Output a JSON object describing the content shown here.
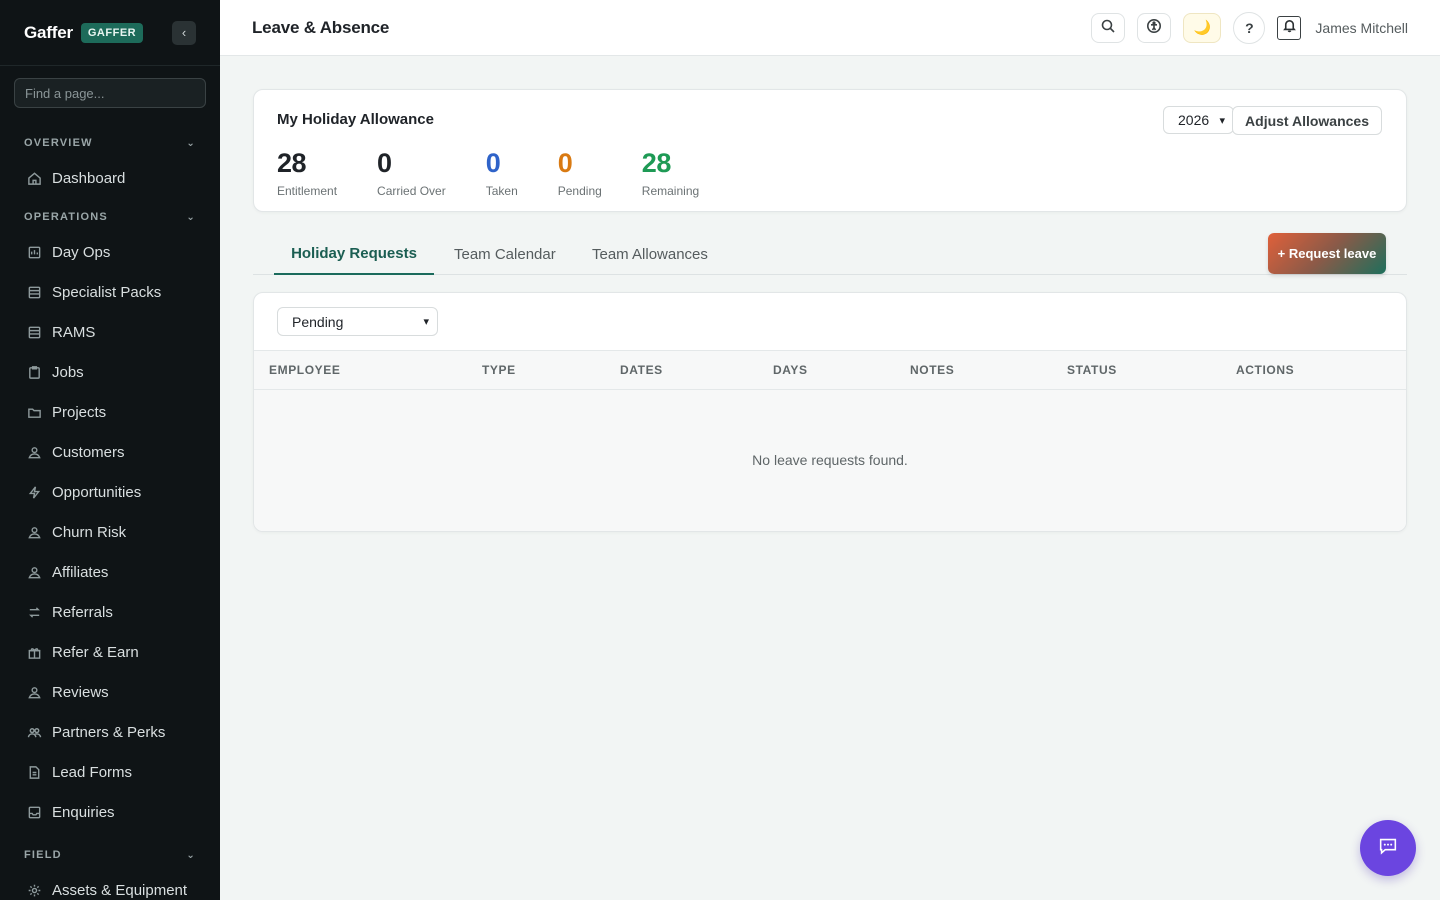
{
  "app": {
    "brand": "Gaffer",
    "badge": "GAFFER",
    "collapse_icon": "‹"
  },
  "sidebar": {
    "search_placeholder": "Find a page...",
    "sections": [
      {
        "title": "OVERVIEW",
        "items": [
          {
            "label": "Dashboard",
            "icon": "home-icon"
          }
        ]
      },
      {
        "title": "OPERATIONS",
        "items": [
          {
            "label": "Day Ops",
            "icon": "calendar-icon"
          },
          {
            "label": "Specialist Packs",
            "icon": "pack-icon"
          },
          {
            "label": "RAMS",
            "icon": "document-stack-icon"
          },
          {
            "label": "Jobs",
            "icon": "clipboard-icon"
          },
          {
            "label": "Projects",
            "icon": "folder-icon"
          },
          {
            "label": "Customers",
            "icon": "user-icon"
          },
          {
            "label": "Opportunities",
            "icon": "bolt-icon"
          },
          {
            "label": "Churn Risk",
            "icon": "user-icon"
          },
          {
            "label": "Affiliates",
            "icon": "user-icon"
          },
          {
            "label": "Referrals",
            "icon": "arrows-icon"
          },
          {
            "label": "Refer & Earn",
            "icon": "gift-icon"
          },
          {
            "label": "Reviews",
            "icon": "user-icon"
          },
          {
            "label": "Partners & Perks",
            "icon": "users-icon"
          },
          {
            "label": "Lead Forms",
            "icon": "form-icon"
          },
          {
            "label": "Enquiries",
            "icon": "inbox-icon"
          }
        ]
      },
      {
        "title": "FIELD",
        "items": [
          {
            "label": "Assets & Equipment",
            "icon": "gear-icon"
          }
        ]
      }
    ]
  },
  "topbar": {
    "title": "Leave & Absence",
    "user": "James Mitchell",
    "help": "?"
  },
  "allowance": {
    "title": "My Holiday Allowance",
    "year": "2026",
    "adjust_label": "Adjust Allowances",
    "stats": [
      {
        "value": "28",
        "label": "Entitlement",
        "color": "#1f2328"
      },
      {
        "value": "0",
        "label": "Carried Over",
        "color": "#1f2328"
      },
      {
        "value": "0",
        "label": "Taken",
        "color": "#2f63c9"
      },
      {
        "value": "0",
        "label": "Pending",
        "color": "#d97a12"
      },
      {
        "value": "28",
        "label": "Remaining",
        "color": "#1e9a55"
      }
    ]
  },
  "tabs": [
    "Holiday Requests",
    "Team Calendar",
    "Team Allowances"
  ],
  "request_button": "+ Request leave",
  "requests": {
    "filter": "Pending",
    "columns": [
      "EMPLOYEE",
      "TYPE",
      "DATES",
      "DAYS",
      "NOTES",
      "STATUS",
      "ACTIONS"
    ],
    "empty_message": "No leave requests found."
  }
}
